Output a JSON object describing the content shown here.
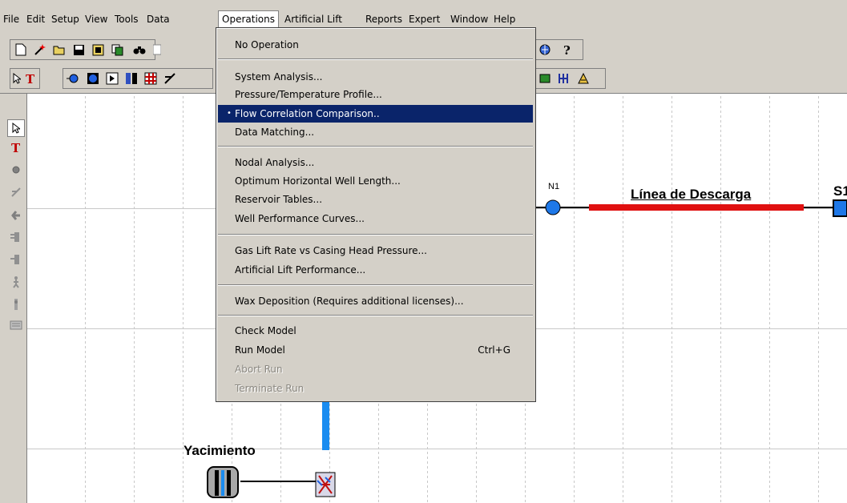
{
  "menubar": {
    "items": [
      "File",
      "Edit",
      "Setup",
      "View",
      "Tools",
      "Data",
      "Operations",
      "Artificial Lift",
      "Reports",
      "Expert",
      "Window",
      "Help"
    ],
    "active": "Operations"
  },
  "toolbar1": {
    "icons": [
      "new-file-icon",
      "wizard-icon",
      "open-folder-icon",
      "save-icon",
      "print-preview-icon",
      "copy-icon",
      "find-icon",
      "table-icon",
      "globe-icon",
      "help-question-icon"
    ]
  },
  "toolbar2": {
    "icons": [
      "select-arrow-icon",
      "text-tool-icon",
      "source-icon",
      "node-icon",
      "connector-icon",
      "pipe-icon",
      "flowline-icon",
      "choke-icon",
      "separator-icon",
      "compressor-icon",
      "pump-icon"
    ]
  },
  "left_tools": {
    "icons": [
      "select-arrow-icon",
      "text-tool-icon",
      "node-circle-icon",
      "choke-icon",
      "well-icon",
      "injection-well-icon",
      "production-well-icon",
      "man-icon",
      "sink-icon",
      "keyboard-icon"
    ]
  },
  "diagram": {
    "node_n1": "N1",
    "flowline_label": "Línea de Descarga",
    "sink_label": "S1",
    "reservoir_label": "Yacimiento",
    "colors": {
      "flowline": "#e01010",
      "wellbore": "#1a8cf0",
      "node": "#1e78e8"
    }
  },
  "operations_menu": {
    "groups": [
      [
        {
          "label": "No Operation"
        }
      ],
      [
        {
          "label": "System Analysis..."
        },
        {
          "label": "Pressure/Temperature Profile..."
        },
        {
          "label": "Flow Correlation Comparison..",
          "selected": true,
          "bullet": "•"
        },
        {
          "label": "Data Matching..."
        }
      ],
      [
        {
          "label": "Nodal Analysis..."
        },
        {
          "label": "Optimum Horizontal Well Length..."
        },
        {
          "label": "Reservoir Tables..."
        },
        {
          "label": "Well Performance Curves..."
        }
      ],
      [
        {
          "label": "Gas Lift Rate vs Casing Head Pressure..."
        },
        {
          "label": "Artificial Lift Performance..."
        }
      ],
      [
        {
          "label": "Wax Deposition (Requires additional licenses)..."
        }
      ],
      [
        {
          "label": "Check Model"
        },
        {
          "label": "Run Model",
          "shortcut": "Ctrl+G"
        },
        {
          "label": "Abort Run",
          "disabled": true
        },
        {
          "label": "Terminate Run",
          "disabled": true
        }
      ]
    ]
  }
}
